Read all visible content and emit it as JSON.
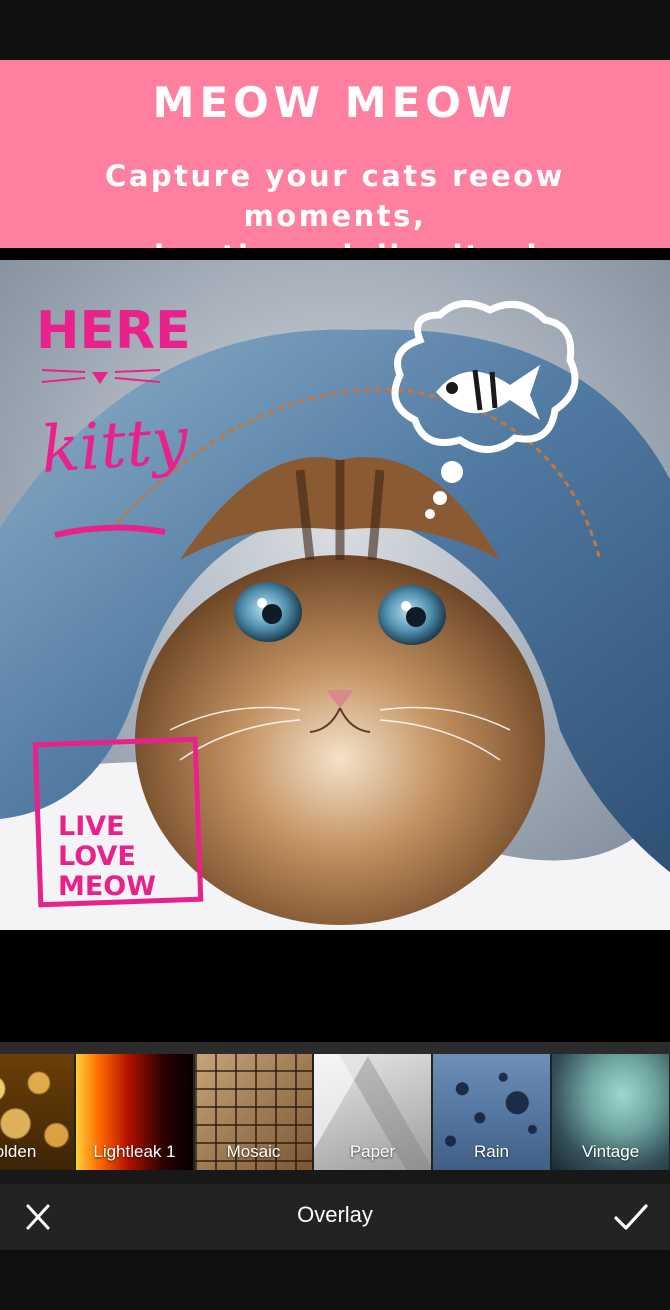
{
  "banner": {
    "title": "MEOW MEOW",
    "subtitle_line1": "Capture your cats reeow moments,",
    "subtitle_line2": "play time, daily ritual"
  },
  "stickers": {
    "here_kitty_line1": "HERE",
    "here_kitty_line2": "kitty",
    "live_love_meow_line1": "LIVE",
    "live_love_meow_line2": "LOVE",
    "live_love_meow_line3": "MEOW"
  },
  "filters": [
    {
      "label": "olden",
      "icon": "golden-bokeh-thumbnail"
    },
    {
      "label": "Lightleak 1",
      "icon": "lightleak-thumbnail"
    },
    {
      "label": "Mosaic",
      "icon": "mosaic-thumbnail"
    },
    {
      "label": "Paper",
      "icon": "paper-thumbnail"
    },
    {
      "label": "Rain",
      "icon": "rain-thumbnail"
    },
    {
      "label": "Vintage",
      "icon": "vintage-thumbnail"
    }
  ],
  "toolbar": {
    "title": "Overlay",
    "close_icon": "close-icon",
    "confirm_icon": "checkmark-icon"
  },
  "colors": {
    "banner": "#FF7F9E",
    "sticker_pink": "#E8228A"
  }
}
